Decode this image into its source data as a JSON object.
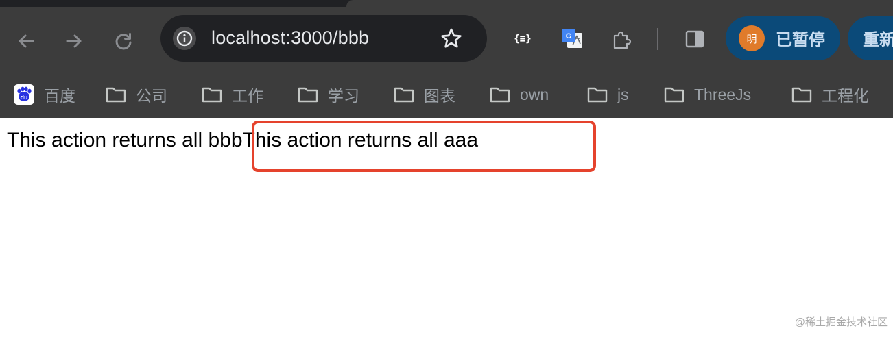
{
  "browser": {
    "nav": {
      "back_icon": "arrow-left-icon",
      "forward_icon": "arrow-right-icon",
      "reload_icon": "reload-icon"
    },
    "address_bar": {
      "url": "localhost:3000/bbb",
      "site_info_icon": "info-icon",
      "bookmark_icon": "star-icon"
    },
    "extensions": {
      "json_viewer_label": "{≡}",
      "translate_icon": "google-translate-icon",
      "extensions_icon": "puzzle-icon",
      "side_panel_icon": "side-panel-icon"
    },
    "profile": {
      "avatar_char": "明",
      "label": "已暂停",
      "avatar_color": "#e07b2a"
    },
    "relaunch": {
      "label": "重新"
    },
    "bookmarks": [
      {
        "label": "百度",
        "icon": "baidu-icon"
      },
      {
        "label": "公司",
        "icon": "folder-icon"
      },
      {
        "label": "工作",
        "icon": "folder-icon"
      },
      {
        "label": "学习",
        "icon": "folder-icon"
      },
      {
        "label": "图表",
        "icon": "folder-icon"
      },
      {
        "label": "own",
        "icon": "folder-icon"
      },
      {
        "label": "js",
        "icon": "folder-icon"
      },
      {
        "label": "ThreeJs",
        "icon": "folder-icon"
      },
      {
        "label": "工程化",
        "icon": "folder-icon"
      }
    ],
    "baidu_logo_text": "du"
  },
  "page": {
    "text_1": "This action returns all bbb",
    "text_2": "This action returns all aaa",
    "highlight_color": "#e5432d"
  },
  "watermark": "@稀土掘金技术社区"
}
